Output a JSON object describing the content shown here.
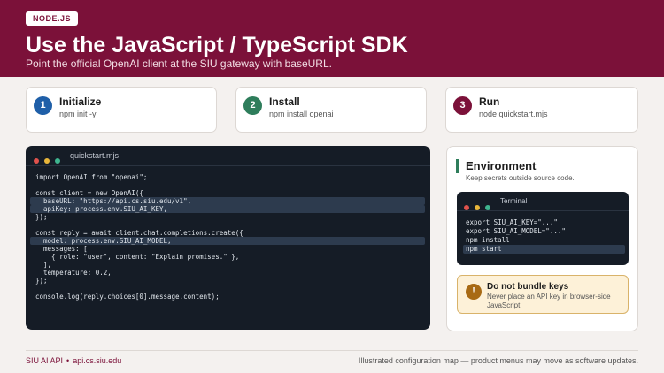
{
  "header": {
    "badge": "NODE.JS",
    "title": "Use the JavaScript / TypeScript SDK",
    "subtitle": "Point the official OpenAI client at the SIU gateway with baseURL."
  },
  "steps": [
    {
      "number": "1",
      "title": "Initialize",
      "command": "npm init -y",
      "color": "#1f5fa8"
    },
    {
      "number": "2",
      "title": "Install",
      "command": "npm install openai",
      "color": "#2e7d5b"
    },
    {
      "number": "3",
      "title": "Run",
      "command": "node quickstart.mjs",
      "color": "#7b1139"
    }
  ],
  "code_window": {
    "filename": "quickstart.mjs",
    "lines": [
      "import OpenAI from \"openai\";",
      "",
      "const client = new OpenAI({",
      "  baseURL: \"https://api.cs.siu.edu/v1\",",
      "  apiKey: process.env.SIU_AI_KEY,",
      "});",
      "",
      "const reply = await client.chat.completions.create({",
      "  model: process.env.SIU_AI_MODEL,",
      "  messages: [",
      "    { role: \"user\", content: \"Explain promises.\" },",
      "  ],",
      "  temperature: 0.2,",
      "});",
      "",
      "console.log(reply.choices[0].message.content);"
    ],
    "highlighted_lines": [
      3,
      4,
      8
    ]
  },
  "environment": {
    "title": "Environment",
    "subtitle": "Keep secrets outside source code.",
    "terminal_title": "Terminal",
    "terminal_lines": [
      "export SIU_AI_KEY=\"...\"",
      "export SIU_AI_MODEL=\"...\"",
      "npm install",
      "npm start"
    ],
    "terminal_highlighted": [
      3
    ],
    "warning": {
      "icon": "!",
      "title": "Do not bundle keys",
      "text": "Never place an API key in browser-side JavaScript."
    }
  },
  "window_dots": [
    "#e0524c",
    "#e8b63a",
    "#3fb58f"
  ],
  "footer": {
    "brand": "SIU AI API",
    "separator": "•",
    "domain": "api.cs.siu.edu",
    "note": "Illustrated configuration map — product menus may move as software updates."
  },
  "colors": {
    "brand": "#7b1139",
    "code_bg": "#151c26",
    "highlight": "#2d3b4e",
    "warning_bg": "#fdf1d8"
  }
}
